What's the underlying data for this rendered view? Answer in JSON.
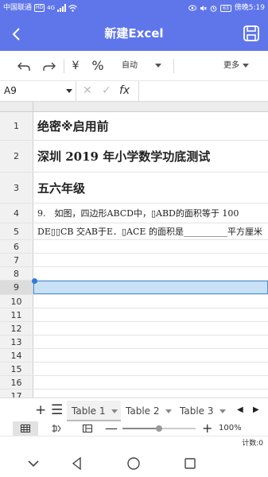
{
  "status_bar": {
    "carrier": "中国联通",
    "hd_badge": "HD",
    "network": "4G",
    "battery": "63",
    "time": "傍晚5:19"
  },
  "app_bar": {
    "title": "新建Excel",
    "back_icon": "back-arrow-icon",
    "save_icon": "save-icon",
    "color": "#5f76ea"
  },
  "toolbar": {
    "undo_icon": "undo-icon",
    "redo_icon": "redo-icon",
    "currency_label": "¥",
    "percent_label": "%",
    "format_label": "自动",
    "more_label": "更多"
  },
  "formula_bar": {
    "cell_ref": "A9",
    "cancel_glyph": "✕",
    "confirm_glyph": "✓",
    "fx_label": "fx"
  },
  "rows": [
    {
      "num": "1",
      "text": "绝密※启用前"
    },
    {
      "num": "2",
      "text": "深圳 2019 年小学数学功底测试"
    },
    {
      "num": "3",
      "text": "五六年级"
    },
    {
      "num": "4",
      "text": "9.　如图，四边形ABCD中，▯ABD的面积等于 100"
    },
    {
      "num": "5",
      "text": "DE▯▯CB 交AB于E．▯ACE 的面积是__________平方厘米"
    },
    {
      "num": "6",
      "text": ""
    },
    {
      "num": "7",
      "text": ""
    },
    {
      "num": "8",
      "text": ""
    },
    {
      "num": "9",
      "text": ""
    },
    {
      "num": "10",
      "text": ""
    },
    {
      "num": "11",
      "text": ""
    },
    {
      "num": "12",
      "text": ""
    },
    {
      "num": "13",
      "text": ""
    },
    {
      "num": "14",
      "text": ""
    },
    {
      "num": "15",
      "text": ""
    },
    {
      "num": "16",
      "text": ""
    },
    {
      "num": "17",
      "text": ""
    }
  ],
  "selected_row": "9",
  "sheets": [
    "Table 1",
    "Table 2",
    "Table 3"
  ],
  "active_sheet": "Table 1",
  "view_bar": {
    "zoom_label": "100%",
    "zoom_fraction": 0.5
  },
  "count_bar": {
    "label": "计数:0"
  }
}
